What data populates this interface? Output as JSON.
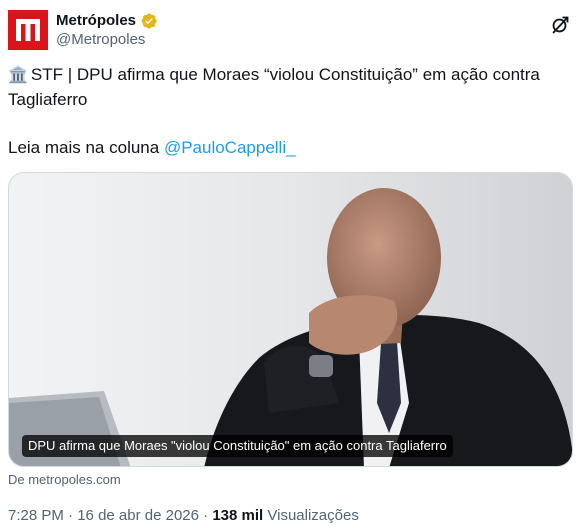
{
  "account": {
    "name": "Metrópoles",
    "handle": "@Metropoles",
    "verified_color": "#e2b719",
    "brand_color": "#d9141b"
  },
  "tweet": {
    "line1_icon": "🏛️",
    "line1_text": "STF | DPU afirma que Moraes “violou Constituição” em ação contra Tagliaferro",
    "line2_prefix": "Leia mais na coluna ",
    "mention": "@PauloCappelli_"
  },
  "media": {
    "caption": "DPU afirma que Moraes \"violou Constituição\" em ação contra Tagliaferro",
    "source": "De metropoles.com"
  },
  "meta": {
    "time": "7:28 PM",
    "separator": " · ",
    "date": "16 de abr de 2026",
    "views_count": "138 mil",
    "views_label": " Visualizações"
  },
  "icons": {
    "avatar": "metropoles-logo-icon",
    "verified": "verified-badge-icon",
    "grok": "grok-icon"
  }
}
